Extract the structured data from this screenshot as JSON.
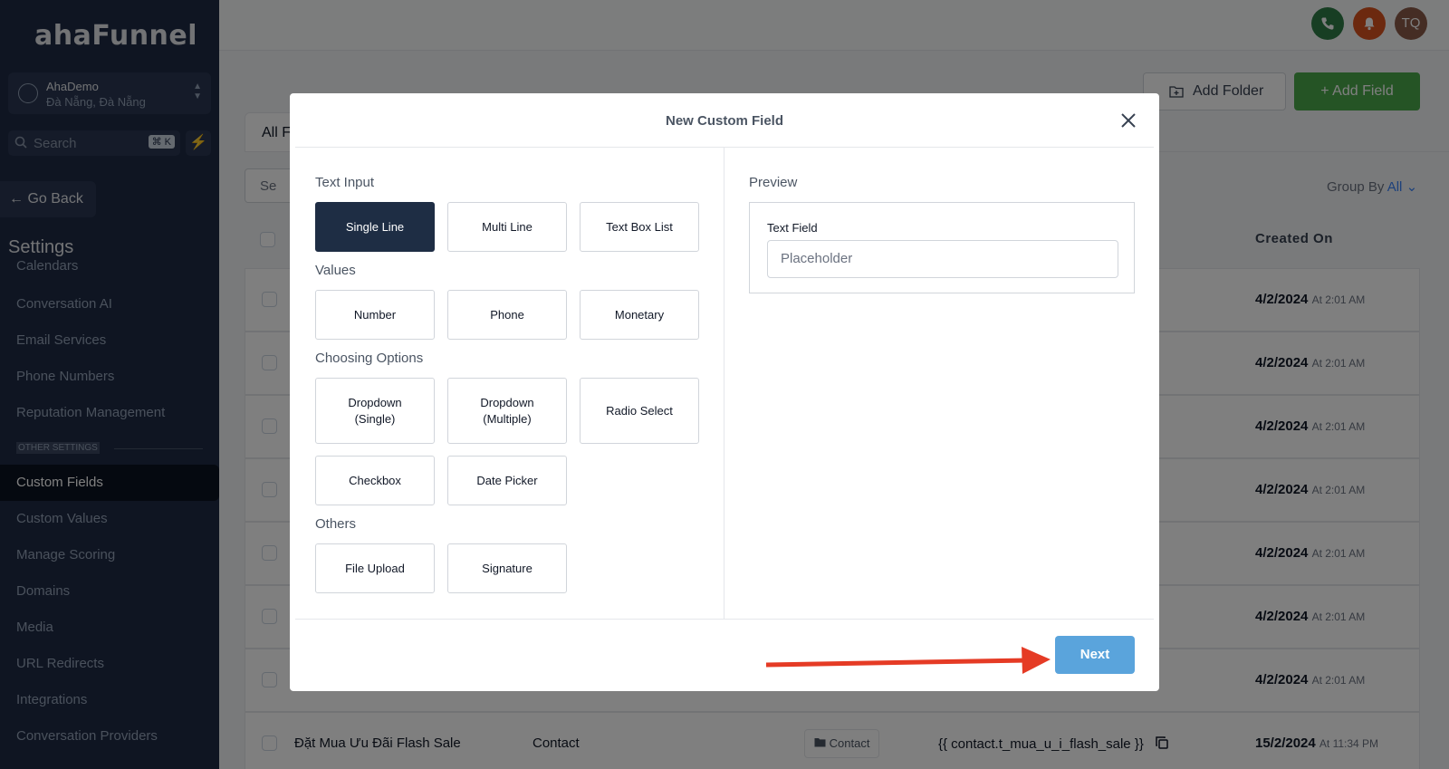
{
  "sidebar": {
    "logo": "ahaFunnel",
    "account_name": "AhaDemo",
    "account_location": "Đà Nẵng, Đà Nẵng",
    "search_placeholder": "Search",
    "search_shortcut": "⌘ K",
    "go_back": "Go Back",
    "settings_title": "Settings",
    "cut_item": "Calendars",
    "items_top": [
      "Conversation AI",
      "Email Services",
      "Phone Numbers",
      "Reputation Management"
    ],
    "section_label": "OTHER SETTINGS",
    "items_bottom": [
      "Custom Fields",
      "Custom Values",
      "Manage Scoring",
      "Domains",
      "Media",
      "URL Redirects",
      "Integrations",
      "Conversation Providers"
    ],
    "active_item": "Custom Fields"
  },
  "topbar": {
    "avatar_initials": "TQ",
    "colors": {
      "phone": "#2f7d46",
      "bell": "#d9531e",
      "avatar": "#8a5a48"
    }
  },
  "main": {
    "add_folder_label": "Add Folder",
    "add_field_label": "+ Add Field",
    "tab_all": "All F",
    "search_fragment": "Se",
    "group_by_label": "Group By",
    "group_by_value": "All",
    "col_created_on": "Created On",
    "rows": [
      {
        "date": "4/2/2024",
        "time": "At 2:01 AM"
      },
      {
        "date": "4/2/2024",
        "time": "At 2:01 AM"
      },
      {
        "date": "4/2/2024",
        "time": "At 2:01 AM"
      },
      {
        "date": "4/2/2024",
        "time": "At 2:01 AM"
      },
      {
        "date": "4/2/2024",
        "time": "At 2:01 AM"
      },
      {
        "date": "4/2/2024",
        "time": "At 2:01 AM"
      },
      {
        "date": "4/2/2024",
        "time": "At 2:01 AM"
      }
    ],
    "last_row": {
      "name": "Đặt Mua Ưu Đãi Flash Sale",
      "type": "Contact",
      "folder": "Contact",
      "key": "{{ contact.t_mua_u_i_flash_sale }}",
      "date": "15/2/2024",
      "time": "At 11:34 PM"
    }
  },
  "modal": {
    "title": "New Custom Field",
    "groups": {
      "text_input": "Text Input",
      "values": "Values",
      "choosing_options": "Choosing Options",
      "others": "Others"
    },
    "options": {
      "single_line": "Single Line",
      "multi_line": "Multi Line",
      "text_box_list": "Text Box List",
      "number": "Number",
      "phone": "Phone",
      "monetary": "Monetary",
      "dropdown_single_1": "Dropdown",
      "dropdown_single_2": "(Single)",
      "dropdown_multiple_1": "Dropdown",
      "dropdown_multiple_2": "(Multiple)",
      "radio_select": "Radio Select",
      "checkbox": "Checkbox",
      "date_picker": "Date Picker",
      "file_upload": "File Upload",
      "signature": "Signature"
    },
    "selected_option": "Single Line",
    "preview_label": "Preview",
    "preview_field_label": "Text Field",
    "preview_placeholder": "Placeholder",
    "next_label": "Next",
    "arrow_color": "#e53b25"
  }
}
